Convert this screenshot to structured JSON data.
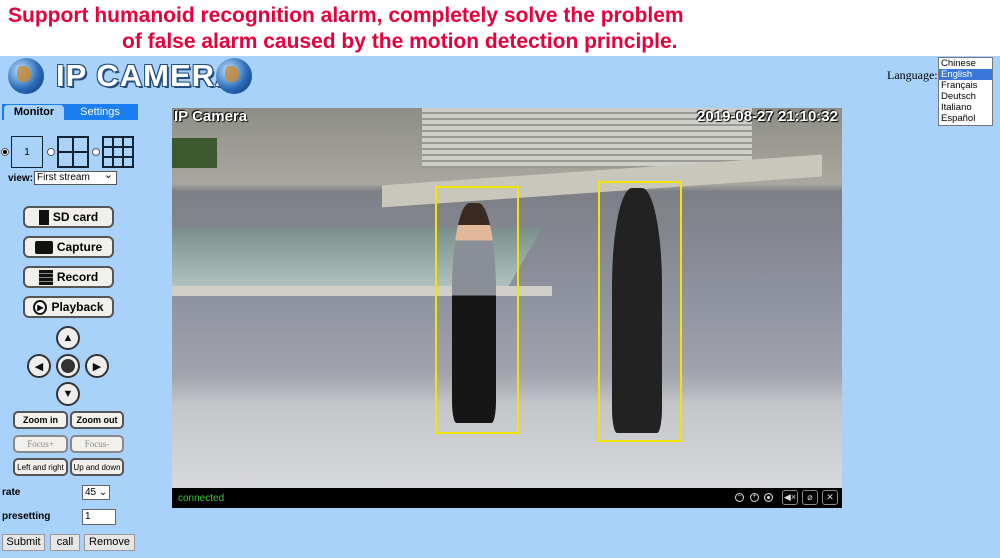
{
  "banner": {
    "line1": "Support humanoid recognition alarm, completely solve the problem",
    "line2": "of false alarm caused by the motion detection principle."
  },
  "header": {
    "logo": "IP CAMERA",
    "language_label": "Language:",
    "languages": [
      "Chinese",
      "English",
      "Français",
      "Deutsch",
      "Italiano",
      "Español"
    ],
    "selected_language": "English"
  },
  "sidebar": {
    "tabs": [
      {
        "label": "Monitor",
        "active": true
      },
      {
        "label": "Settings",
        "active": false
      }
    ],
    "layouts": [
      {
        "label": "1",
        "selected": true
      },
      {
        "label": "",
        "selected": false
      },
      {
        "label": "",
        "selected": false
      }
    ],
    "view_label": "view:",
    "view_value": "First stream",
    "buttons": {
      "sd": "SD card",
      "capture": "Capture",
      "record": "Record",
      "playback": "Playback"
    },
    "ptz": {
      "zoom_in": "Zoom in",
      "zoom_out": "Zoom out",
      "focus_plus": "Focus+",
      "focus_minus": "Focus-",
      "left_right": "Left and right",
      "up_down": "Up and down"
    },
    "rate_label": "rate",
    "rate_value": "45",
    "presetting_label": "presetting",
    "presetting_value": "1",
    "submit": "Submit",
    "call": "call",
    "remove": "Remove"
  },
  "video": {
    "osd_title": "IP Camera",
    "osd_time": "2019-08-27 21:10:32",
    "status": "connected",
    "detection_color": "#f2e600"
  }
}
